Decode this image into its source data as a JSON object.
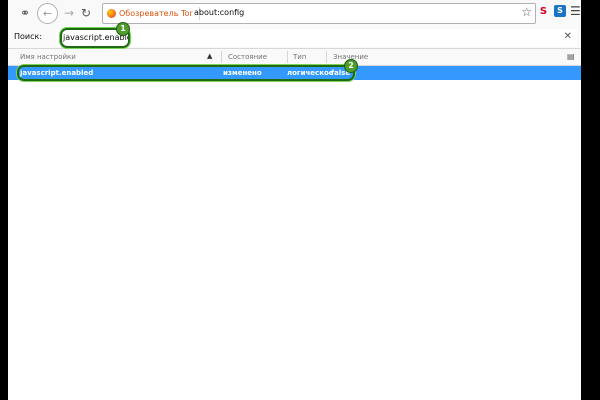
{
  "toolbar": {
    "browser_name": "Обозреватель Tor",
    "url": "about:config"
  },
  "search": {
    "label": "Поиск:",
    "value": "javascript.enable"
  },
  "table": {
    "columns": [
      "Имя настройки",
      "Состояние",
      "Тип",
      "Значение"
    ],
    "rows": [
      {
        "name": "javascript.enabled",
        "status": "изменено",
        "type": "логическое",
        "value": "false"
      }
    ]
  },
  "annotations": {
    "callout1": "1",
    "callout2": "2"
  },
  "colors": {
    "selection": "#3399ff",
    "callout": "#4f9d2a",
    "brand": "#d7560e"
  }
}
